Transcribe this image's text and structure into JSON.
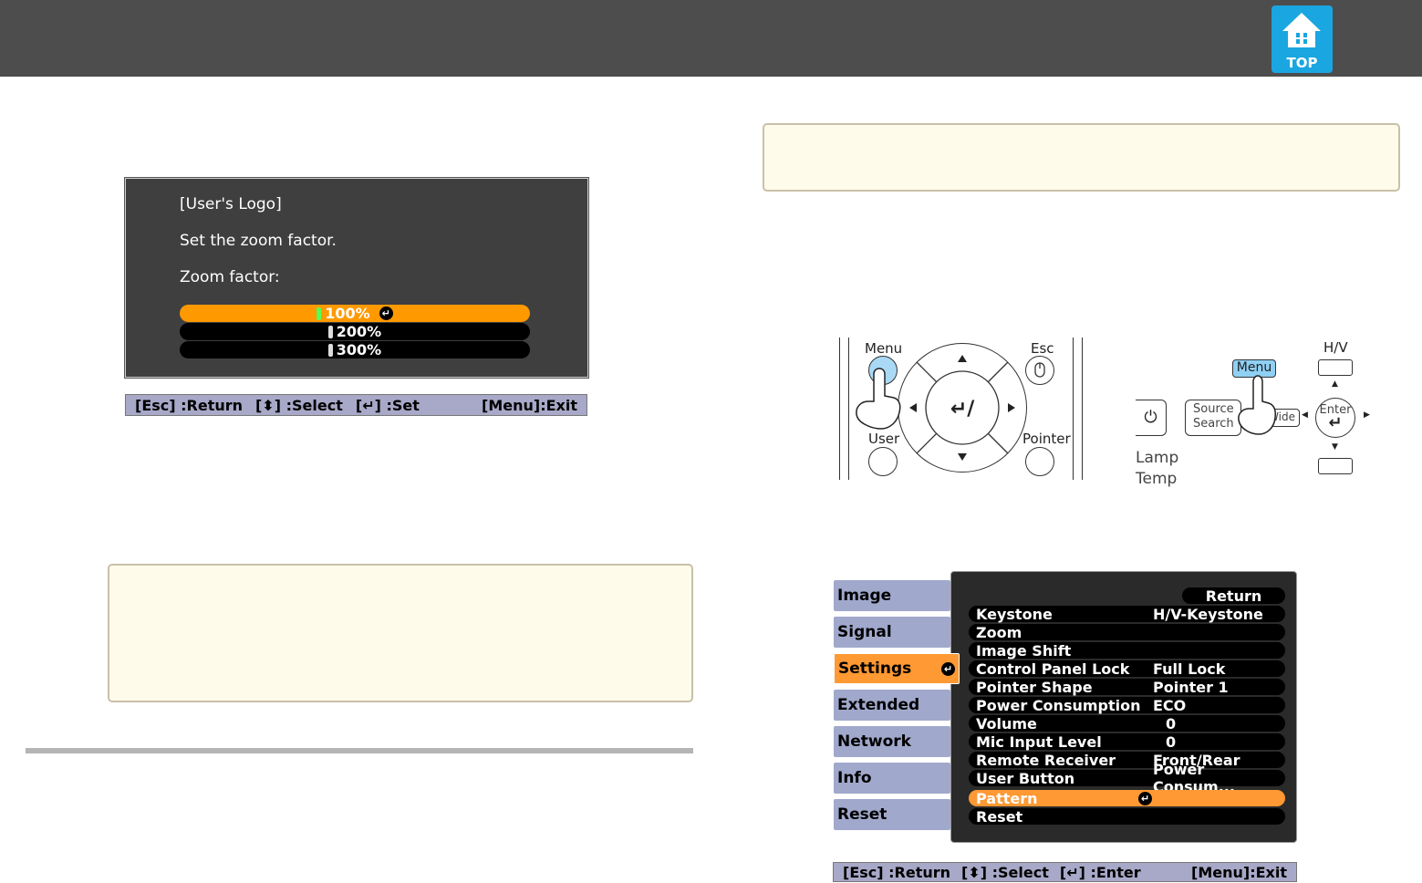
{
  "header": {
    "top_label": "TOP",
    "top_icon": "home-icon"
  },
  "zoom_dialog": {
    "title": "[User's Logo]",
    "instruction": "Set the zoom factor.",
    "label": "Zoom factor:",
    "options": [
      "100%",
      "200%",
      "300%"
    ],
    "selected_index": 0,
    "help": {
      "esc": "[Esc] :Return",
      "select": "[⬍] :Select",
      "set": "[↵] :Set",
      "exit": "[Menu]:Exit"
    }
  },
  "remote_illustration": {
    "labels": {
      "menu": "Menu",
      "esc": "Esc",
      "user": "User",
      "pointer": "Pointer"
    },
    "enter_symbol": "↵/⎙"
  },
  "panel_illustration": {
    "labels": {
      "hv": "H/V",
      "menu": "Menu",
      "source": "Source",
      "search": "Search",
      "wide": "Wide",
      "enter": "Enter",
      "lamp": "Lamp",
      "temp": "Temp"
    }
  },
  "config_menu": {
    "tabs": [
      "Image",
      "Signal",
      "Settings",
      "Extended",
      "Network",
      "Info",
      "Reset"
    ],
    "active_tab_index": 2,
    "return_label": "Return",
    "items": [
      {
        "label": "Keystone",
        "value": "H/V-Keystone"
      },
      {
        "label": "Zoom",
        "value": ""
      },
      {
        "label": "Image Shift",
        "value": ""
      },
      {
        "label": "Control Panel Lock",
        "value": "Full Lock"
      },
      {
        "label": "Pointer Shape",
        "value": "Pointer 1"
      },
      {
        "label": "Power Consumption",
        "value": "ECO"
      },
      {
        "label": "Volume",
        "value": "0"
      },
      {
        "label": "Mic Input Level",
        "value": "0"
      },
      {
        "label": "Remote Receiver",
        "value": "Front/Rear"
      },
      {
        "label": "User Button",
        "value": "Power Consum..."
      },
      {
        "label": "Pattern",
        "value": ""
      },
      {
        "label": "Reset",
        "value": ""
      }
    ],
    "selected_item_index": 10,
    "help": {
      "esc": "[Esc] :Return",
      "select": "[⬍] :Select",
      "enter": "[↵] :Enter",
      "exit": "[Menu]:Exit"
    }
  },
  "colors": {
    "header": "#4d4d4d",
    "osd_bg": "#3f3f3f",
    "highlight": "#ff9900",
    "tab": "#a0a8cc",
    "note_bg": "#fffbeb"
  }
}
